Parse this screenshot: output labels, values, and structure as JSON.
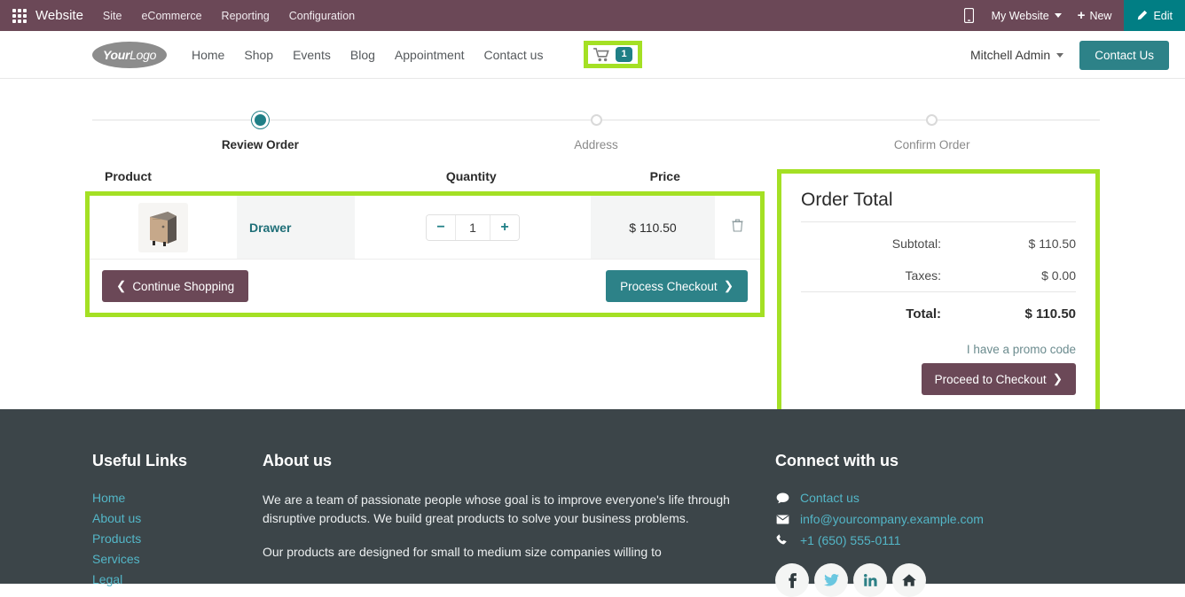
{
  "backend": {
    "app_name": "Website",
    "menu": [
      "Site",
      "eCommerce",
      "Reporting",
      "Configuration"
    ],
    "mobile_icon": "mobile-preview-icon",
    "website_selector": "My Website",
    "new_label": "New",
    "edit_label": "Edit",
    "brand_color": "#6b4857",
    "accent_color": "#017e84"
  },
  "site_header": {
    "logo_your": "Your",
    "logo_logo": "Logo",
    "nav": [
      "Home",
      "Shop",
      "Events",
      "Blog",
      "Appointment",
      "Contact us"
    ],
    "cart_icon": "shopping-cart-icon",
    "cart_count": "1",
    "user": "Mitchell Admin",
    "contact_button": "Contact Us"
  },
  "wizard": {
    "steps": [
      {
        "label": "Review Order",
        "state": "active"
      },
      {
        "label": "Address",
        "state": "pending"
      },
      {
        "label": "Confirm Order",
        "state": "pending"
      }
    ]
  },
  "cart": {
    "headers": {
      "product": "Product",
      "quantity": "Quantity",
      "price": "Price"
    },
    "rows": [
      {
        "image": "drawer-product-image",
        "name": "Drawer",
        "qty_decrease": "−",
        "qty": "1",
        "qty_increase": "+",
        "price": "$ 110.50",
        "delete_icon": "trash-icon"
      }
    ],
    "continue_shopping": "Continue Shopping",
    "process_checkout": "Process Checkout"
  },
  "order_total": {
    "title": "Order Total",
    "lines": [
      {
        "label": "Subtotal:",
        "value": "$ 110.50",
        "emphasis": false
      },
      {
        "label": "Taxes:",
        "value": "$ 0.00",
        "emphasis": false
      },
      {
        "label": "Total:",
        "value": "$ 110.50",
        "emphasis": true
      }
    ],
    "promo_link": "I have a promo code",
    "proceed_button": "Proceed to Checkout"
  },
  "footer": {
    "useful_links": {
      "title": "Useful Links",
      "items": [
        "Home",
        "About us",
        "Products",
        "Services",
        "Legal"
      ]
    },
    "about": {
      "title": "About us",
      "paragraph1": "We are a team of passionate people whose goal is to improve everyone's life through disruptive products. We build great products to solve your business problems.",
      "paragraph2": "Our products are designed for small to medium size companies willing to"
    },
    "connect": {
      "title": "Connect with us",
      "contact_label": "Contact us",
      "email": "info@yourcompany.example.com",
      "phone": "+1 (650) 555-0111",
      "socials": [
        "facebook-icon",
        "twitter-icon",
        "linkedin-icon",
        "home-icon"
      ]
    }
  },
  "highlight_color": "#a4e024"
}
